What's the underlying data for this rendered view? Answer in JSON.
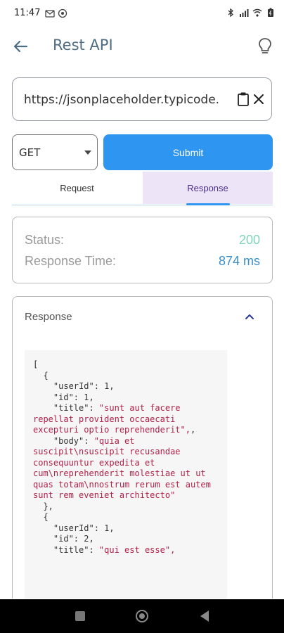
{
  "status_bar": {
    "time": "11:47",
    "left_icons": [
      "gmail-icon",
      "notification-icon"
    ],
    "right_icons": [
      "bluetooth-icon",
      "signal-icon",
      "wifi-icon",
      "battery-icon"
    ]
  },
  "app_bar": {
    "title": "Rest API",
    "back_icon": "arrow-left-icon",
    "action_icon": "lightbulb-icon"
  },
  "url_field": {
    "value": "https://jsonplaceholder.typicode.",
    "paste_icon": "clipboard-icon",
    "clear_icon": "close-icon"
  },
  "method": {
    "value": "GET"
  },
  "submit": {
    "label": "Submit"
  },
  "tabs": [
    {
      "label": "Request",
      "selected": false
    },
    {
      "label": "Response",
      "selected": true
    }
  ],
  "status_card": {
    "status_label": "Status:",
    "status_value": "200",
    "time_label": "Response Time:",
    "time_value": "874 ms"
  },
  "response_panel": {
    "header": "Response",
    "collapse_icon": "chevron-up-icon",
    "items": [
      {
        "userId": "1",
        "id": "1",
        "title": "\"sunt aut facere repellat provident occaecati excepturi optio reprehenderit\"",
        "body": "\"quia et suscipit\\nsuscipit recusandae consequuntur expedita et cum\\nreprehenderit molestiae ut ut quas totam\\nnostrum rerum est autem sunt rem eveniet architecto\""
      },
      {
        "userId": "1",
        "id": "2",
        "title": "\"qui est esse\","
      }
    ]
  },
  "colors": {
    "accent": "#2e95f0",
    "status_ok": "#7fd4b9",
    "time_value": "#3a8fc7",
    "json_string": "#b0214a",
    "tab_selected_bg": "#ede5f7"
  }
}
